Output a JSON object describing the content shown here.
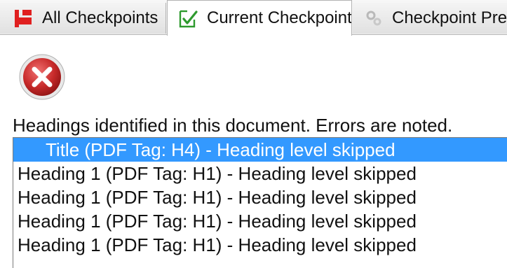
{
  "tabs": [
    {
      "label": "All Checkpoints",
      "icon": "red-flag-icon"
    },
    {
      "label": "Current Checkpoint",
      "icon": "checkmark-document-icon",
      "selected": true
    },
    {
      "label": "Checkpoint Pre",
      "icon": "gear-icon"
    }
  ],
  "panel": {
    "status_icon": "error-icon",
    "description": "Headings identified in this document. Errors are noted.",
    "items": [
      {
        "text": "Title (PDF Tag: H4) - Heading level skipped",
        "selected": true
      },
      {
        "text": "Heading 1 (PDF Tag: H1) - Heading level skipped",
        "selected": false
      },
      {
        "text": "Heading 1 (PDF Tag: H1) - Heading level skipped",
        "selected": false
      },
      {
        "text": "Heading 1 (PDF Tag: H1) - Heading level skipped",
        "selected": false
      },
      {
        "text": "Heading 1 (PDF Tag: H1) - Heading level skipped",
        "selected": false
      }
    ]
  },
  "colors": {
    "selection": "#3399ff",
    "error_red": "#c72a2a",
    "flag_red": "#e02020",
    "check_green": "#2e9a2e"
  }
}
